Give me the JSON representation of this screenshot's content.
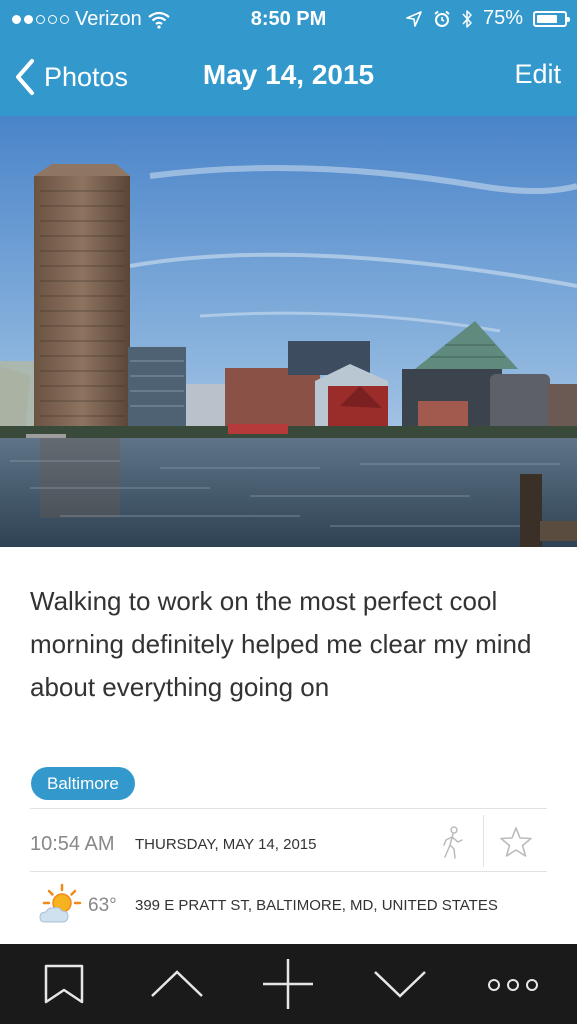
{
  "status_bar": {
    "carrier": "Verizon",
    "time": "8:50 PM",
    "battery_text": "75%",
    "battery_level": 0.75,
    "signal_bars_filled": 2,
    "signal_bars_total": 5
  },
  "nav": {
    "back_label": "Photos",
    "title": "May 14, 2015",
    "edit_label": "Edit"
  },
  "entry": {
    "text": "Walking to work on the most perfect cool morning definitely helped me clear my mind about everything going on",
    "tag": "Baltimore",
    "time": "10:54 AM",
    "date": "THURSDAY, MAY 14, 2015",
    "temperature": "63°",
    "address": "399 E PRATT ST, BALTIMORE, MD, UNITED STATES",
    "starred": false
  },
  "icons": {
    "back": "chevron-left-icon",
    "wifi": "wifi-icon",
    "location": "location-arrow-icon",
    "alarm": "alarm-icon",
    "bluetooth": "bluetooth-icon",
    "battery": "battery-icon",
    "activity": "walking-icon",
    "star": "star-icon",
    "weather": "partly-sunny-icon",
    "toolbar": [
      "bookmark-icon",
      "chevron-up-icon",
      "plus-icon",
      "chevron-down-icon",
      "more-icon"
    ]
  },
  "colors": {
    "accent": "#3399cc",
    "toolbar_bg": "#1a1a1a",
    "body_text": "#333333",
    "muted_text": "#888888"
  }
}
